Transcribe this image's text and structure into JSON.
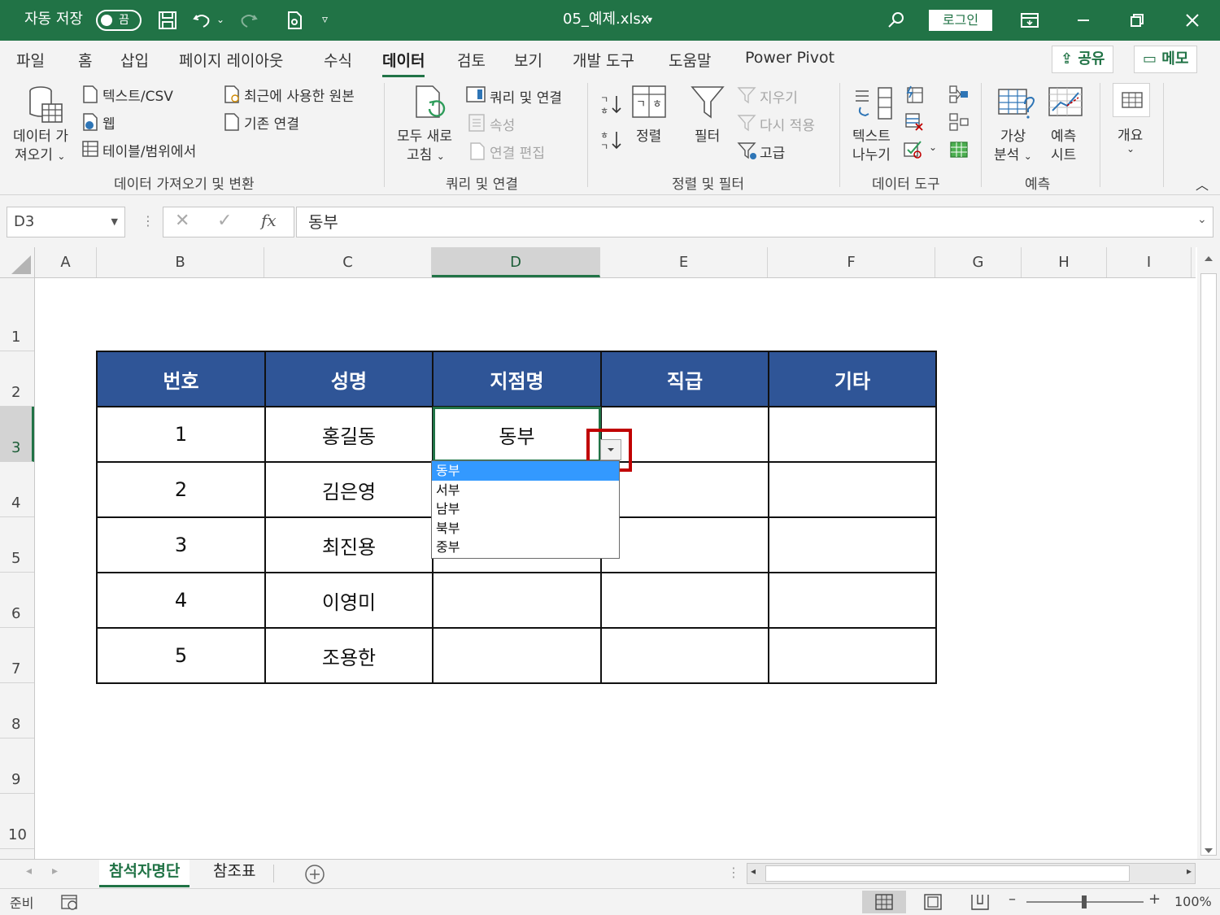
{
  "titlebar": {
    "autosave_label": "자동 저장",
    "autosave_state": "끔",
    "filename": "05_예제.xlsx",
    "login_label": "로그인"
  },
  "tabs": [
    "파일",
    "홈",
    "삽입",
    "페이지 레이아웃",
    "수식",
    "데이터",
    "검토",
    "보기",
    "개발 도구",
    "도움말",
    "Power Pivot"
  ],
  "active_tab": "데이터",
  "share": {
    "share_label": "공유",
    "memo_label": "메모"
  },
  "ribbon": {
    "get_data": {
      "line1": "데이터 가",
      "line2": "져오기"
    },
    "text_csv": "텍스트/CSV",
    "web": "웹",
    "from_table": "테이블/범위에서",
    "recent_sources": "최근에 사용한 원본",
    "existing_conn": "기존 연결",
    "group_get_transform": "데이터 가져오기 및 변환",
    "refresh_all": {
      "line1": "모두 새로",
      "line2": "고침"
    },
    "queries_conn": "쿼리 및 연결",
    "properties": "속성",
    "edit_links": "연결 편집",
    "group_queries": "쿼리 및 연결",
    "sort": "정렬",
    "filter": "필터",
    "clear": "지우기",
    "reapply": "다시 적용",
    "advanced": "고급",
    "group_sort_filter": "정렬 및 필터",
    "text_to_columns": {
      "line1": "텍스트",
      "line2": "나누기"
    },
    "group_data_tools": "데이터 도구",
    "what_if": {
      "line1": "가상",
      "line2": "분석"
    },
    "forecast_sheet": {
      "line1": "예측",
      "line2": "시트"
    },
    "group_forecast": "예측",
    "outline": "개요"
  },
  "formula_bar": {
    "name_box": "D3",
    "fx": "fx",
    "formula": "동부"
  },
  "columns": [
    "A",
    "B",
    "C",
    "D",
    "E",
    "F",
    "G",
    "H",
    "I"
  ],
  "selected_column": "D",
  "rows": [
    "1",
    "2",
    "3",
    "4",
    "5",
    "6",
    "7",
    "8",
    "9",
    "10"
  ],
  "selected_row": "3",
  "table": {
    "headers": [
      "번호",
      "성명",
      "지점명",
      "직급",
      "기타"
    ],
    "rows": [
      [
        "1",
        "홍길동",
        "동부",
        "",
        ""
      ],
      [
        "2",
        "김은영",
        "",
        "",
        ""
      ],
      [
        "3",
        "최진용",
        "",
        "",
        ""
      ],
      [
        "4",
        "이영미",
        "",
        "",
        ""
      ],
      [
        "5",
        "조용한",
        "",
        "",
        ""
      ]
    ]
  },
  "dropdown": {
    "options": [
      "동부",
      "서부",
      "남부",
      "북부",
      "중부"
    ],
    "selected": "동부"
  },
  "sheet_tabs": [
    "참석자명단",
    "참조표"
  ],
  "active_sheet": "참석자명단",
  "status": {
    "ready": "준비",
    "zoom": "100%"
  },
  "colors": {
    "excel_green": "#217346",
    "header_blue": "#2f5597",
    "highlight_red": "#c00000",
    "selection_blue": "#3399ff"
  }
}
